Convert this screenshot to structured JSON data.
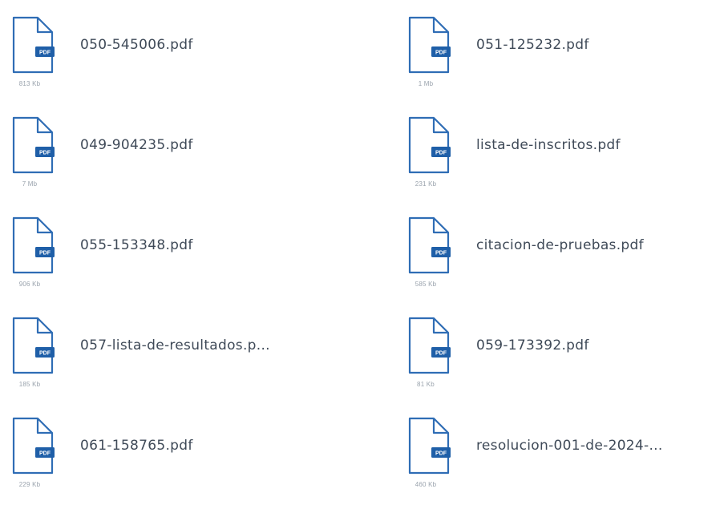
{
  "files": [
    {
      "name": "050-545006.pdf",
      "size": "813 Kb",
      "badge": "PDF",
      "icon": "pdf-file-icon"
    },
    {
      "name": "051-125232.pdf",
      "size": "1 Mb",
      "badge": "PDF",
      "icon": "pdf-file-icon"
    },
    {
      "name": "049-904235.pdf",
      "size": "7 Mb",
      "badge": "PDF",
      "icon": "pdf-file-icon"
    },
    {
      "name": "lista-de-inscritos.pdf",
      "size": "231 Kb",
      "badge": "PDF",
      "icon": "pdf-file-icon"
    },
    {
      "name": "055-153348.pdf",
      "size": "906 Kb",
      "badge": "PDF",
      "icon": "pdf-file-icon"
    },
    {
      "name": "citacion-de-pruebas.pdf",
      "size": "585 Kb",
      "badge": "PDF",
      "icon": "pdf-file-icon"
    },
    {
      "name": "057-lista-de-resultados.p...",
      "size": "185 Kb",
      "badge": "PDF",
      "icon": "pdf-file-icon"
    },
    {
      "name": "059-173392.pdf",
      "size": "81 Kb",
      "badge": "PDF",
      "icon": "pdf-file-icon"
    },
    {
      "name": "061-158765.pdf",
      "size": "229 Kb",
      "badge": "PDF",
      "icon": "pdf-file-icon"
    },
    {
      "name": "resolucion-001-de-2024-...",
      "size": "460 Kb",
      "badge": "PDF",
      "icon": "pdf-file-icon"
    }
  ],
  "colors": {
    "icon_outline": "#2f6db5",
    "badge": "#1f5fa8",
    "name_text": "#3f4a58",
    "size_text": "#9aa3ad"
  }
}
